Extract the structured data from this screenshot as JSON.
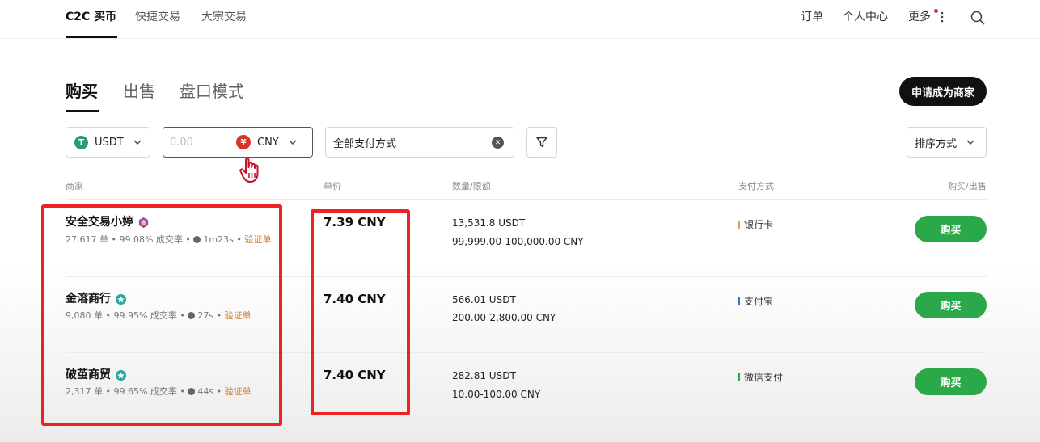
{
  "topnav": {
    "tabs": [
      {
        "label": "C2C 买币"
      },
      {
        "label": "快捷交易"
      },
      {
        "label": "大宗交易"
      }
    ],
    "right": {
      "orders": "订单",
      "profile": "个人中心",
      "more": "更多"
    }
  },
  "subtabs": [
    {
      "label": "购买"
    },
    {
      "label": "出售"
    },
    {
      "label": "盘口模式"
    }
  ],
  "merchant_button": "申请成为商家",
  "filters": {
    "coin": "USDT",
    "coin_icon": "T",
    "amount_placeholder": "0.00",
    "fiat_icon": "¥",
    "fiat": "CNY",
    "payment": "全部支付方式",
    "sort": "排序方式"
  },
  "table": {
    "headers": {
      "merchant": "商家",
      "price": "单价",
      "amount": "数量/限额",
      "payment": "支付方式",
      "action": "购买/出售"
    },
    "rows": [
      {
        "name": "安全交易小婷",
        "orders": "27,617 单",
        "rate": "99.08% 成交率",
        "time": "1m23s",
        "verify": "验证单",
        "price": "7.39 CNY",
        "quantity": "13,531.8 USDT",
        "limit": "99,999.00-100,000.00 CNY",
        "payment": "银行卡",
        "payment_color": "#e2a43a",
        "badge_color": "#8e44e0",
        "button": "购买"
      },
      {
        "name": "金溶商行",
        "orders": "9,080 单",
        "rate": "99.95% 成交率",
        "time": "27s",
        "verify": "验证单",
        "price": "7.40 CNY",
        "quantity": "566.01 USDT",
        "limit": "200.00-2,800.00 CNY",
        "payment": "支付宝",
        "payment_color": "#2c7be5",
        "badge_color": "#2aa6a0",
        "button": "购买"
      },
      {
        "name": "破茧商贸",
        "orders": "2,317 单",
        "rate": "99.65% 成交率",
        "time": "44s",
        "verify": "验证单",
        "price": "7.40 CNY",
        "quantity": "282.81 USDT",
        "limit": "10.00-100.00 CNY",
        "payment": "微信支付",
        "payment_color": "#2aa84a",
        "badge_color": "#2aa6a0",
        "button": "购买"
      }
    ]
  },
  "colors": {
    "buy_green": "#2aa84a",
    "highlight_red": "#ee2222",
    "verify_orange": "#d1782a"
  }
}
